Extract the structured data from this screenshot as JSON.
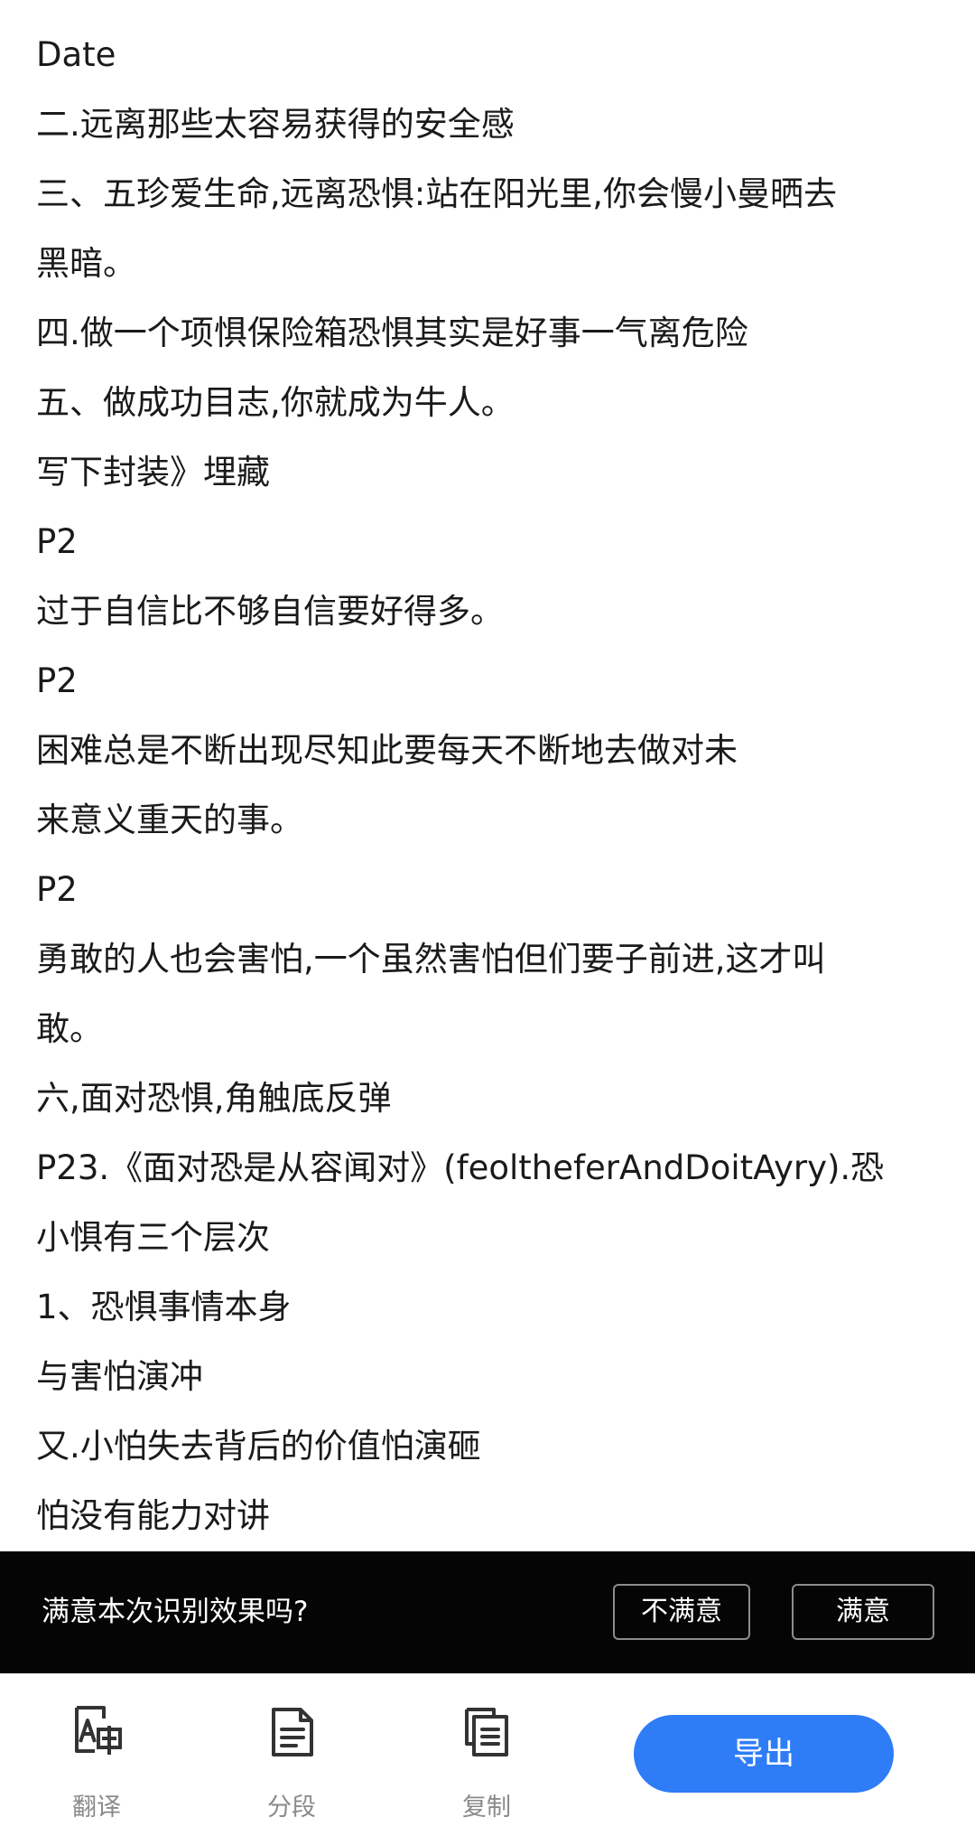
{
  "ocr": {
    "lines": [
      "Date",
      "二.远离那些太容易获得的安全感",
      "三、五珍爱生命,远离恐惧:站在阳光里,你会慢小曼晒去",
      "黑暗。",
      "四.做一个项惧保险箱恐惧其实是好事一气离危险",
      "五、做成功目志,你就成为牛人。",
      "写下封装》埋藏",
      "P2",
      "过于自信比不够自信要好得多。",
      "P2",
      "困难总是不断出现尽知此要每天不断地去做对未",
      "来意义重天的事。",
      "P2",
      "勇敢的人也会害怕,一个虽然害怕但们要子前进,这才叫",
      "敢。",
      "六,面对恐惧,角触底反弹",
      "P23.《面对恐是从容闻对》(feoltheferAndDoitAyry).恐",
      "小惧有三个层次",
      "1、恐惧事情本身",
      "与害怕演冲",
      "又.小怕失去背后的价值怕演砸",
      "怕没有能力对讲"
    ]
  },
  "feedback": {
    "question": "满意本次识别效果吗?",
    "unsatisfied_label": "不满意",
    "satisfied_label": "满意"
  },
  "toolbar": {
    "translate_label": "翻译",
    "segment_label": "分段",
    "copy_label": "复制",
    "export_label": "导出"
  },
  "colors": {
    "accent": "#2f7cf7",
    "feedback_bg": "#050505",
    "icon": "#333333"
  },
  "icons": {
    "translate": "translate-icon",
    "segment": "document-lines-icon",
    "copy": "copy-icon"
  }
}
